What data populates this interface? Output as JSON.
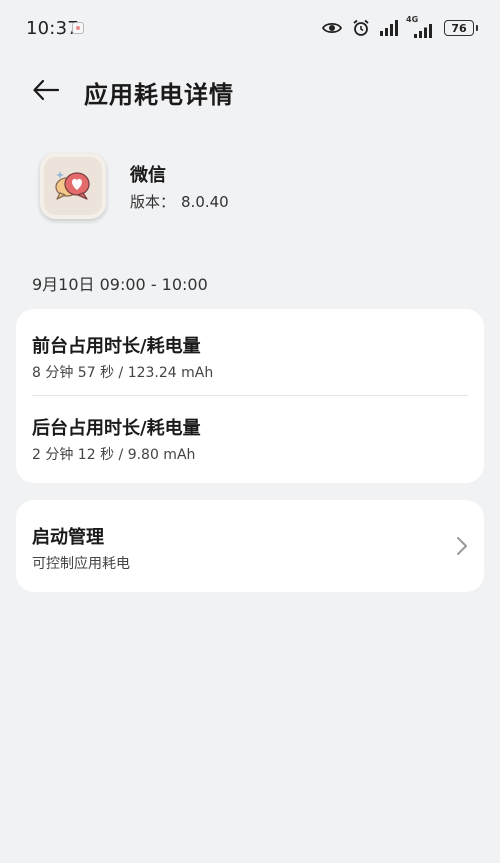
{
  "status_bar": {
    "time": "10:37",
    "network_label": "4G",
    "battery_level": "76",
    "icons": [
      "notification-icon",
      "eye-icon",
      "alarm-icon",
      "signal-icon",
      "signal-4g-icon",
      "battery-icon"
    ]
  },
  "header": {
    "title": "应用耗电详情"
  },
  "app": {
    "name": "微信",
    "version_label": "版本：",
    "version": "8.0.40"
  },
  "date_range": "9月10日 09:00 - 10:00",
  "usage": {
    "foreground": {
      "title": "前台占用时长/耗电量",
      "value": "8 分钟 57 秒 / 123.24 mAh"
    },
    "background": {
      "title": "后台占用时长/耗电量",
      "value": "2 分钟 12 秒 / 9.80 mAh"
    }
  },
  "launch_management": {
    "title": "启动管理",
    "subtitle": "可控制应用耗电"
  },
  "colors": {
    "background": "#f1f2f4",
    "card": "#ffffff",
    "app_icon_heart": "#e46b6b"
  }
}
